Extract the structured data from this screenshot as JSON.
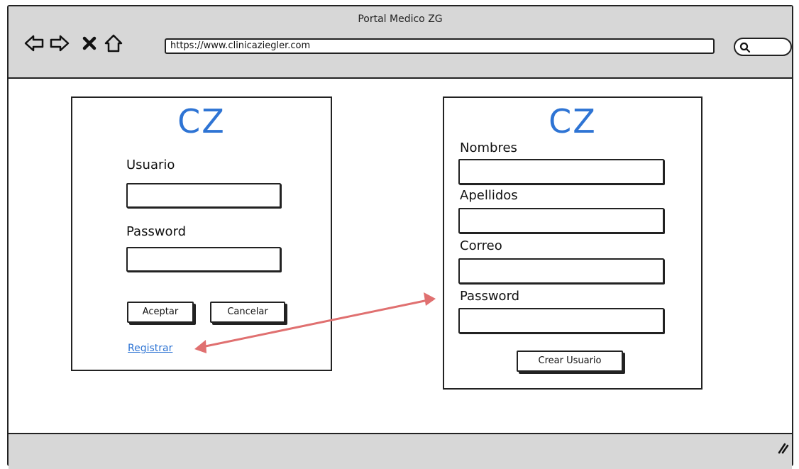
{
  "window": {
    "title": "Portal Medico ZG",
    "url": "https://www.clinicaziegler.com"
  },
  "login": {
    "logo": "CZ",
    "user_label": "Usuario",
    "user_value": "",
    "password_label": "Password",
    "password_value": "",
    "accept_label": "Aceptar",
    "cancel_label": "Cancelar",
    "register_link": "Registrar"
  },
  "register": {
    "logo": "CZ",
    "names_label": "Nombres",
    "lastnames_label": "Apellidos",
    "email_label": "Correo",
    "password_label": "Password",
    "create_label": "Crear Usuario"
  },
  "colors": {
    "brand": "#2e74d4",
    "connector_arrow": "#e07070",
    "chrome": "#d7d7d7"
  },
  "icons": [
    "back-arrow-icon",
    "forward-arrow-icon",
    "stop-icon",
    "home-icon",
    "search-icon",
    "resize-grip-icon"
  ]
}
